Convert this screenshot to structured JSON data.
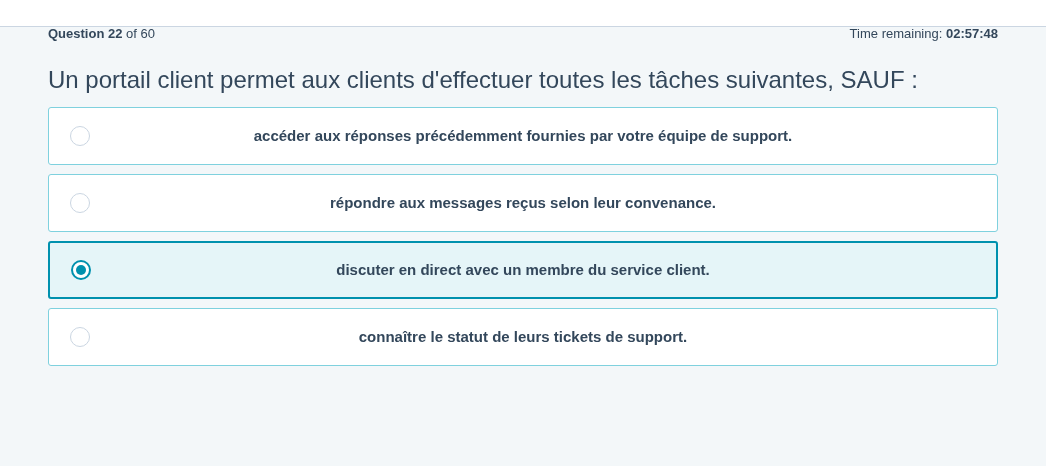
{
  "progress": {
    "question_label": "Question",
    "question_number": "22",
    "of_label": "of 60",
    "time_label": "Time remaining:",
    "time": "02:57:48"
  },
  "question": "Un portail client permet aux clients d'effectuer toutes les tâches suivantes, SAUF :",
  "options": [
    {
      "text": "accéder aux réponses précédemment fournies par votre équipe de support.",
      "selected": false
    },
    {
      "text": "répondre aux messages reçus selon leur convenance.",
      "selected": false
    },
    {
      "text": "discuter en direct avec un membre du service client.",
      "selected": true
    },
    {
      "text": "connaître le statut de leurs tickets de support.",
      "selected": false
    }
  ]
}
